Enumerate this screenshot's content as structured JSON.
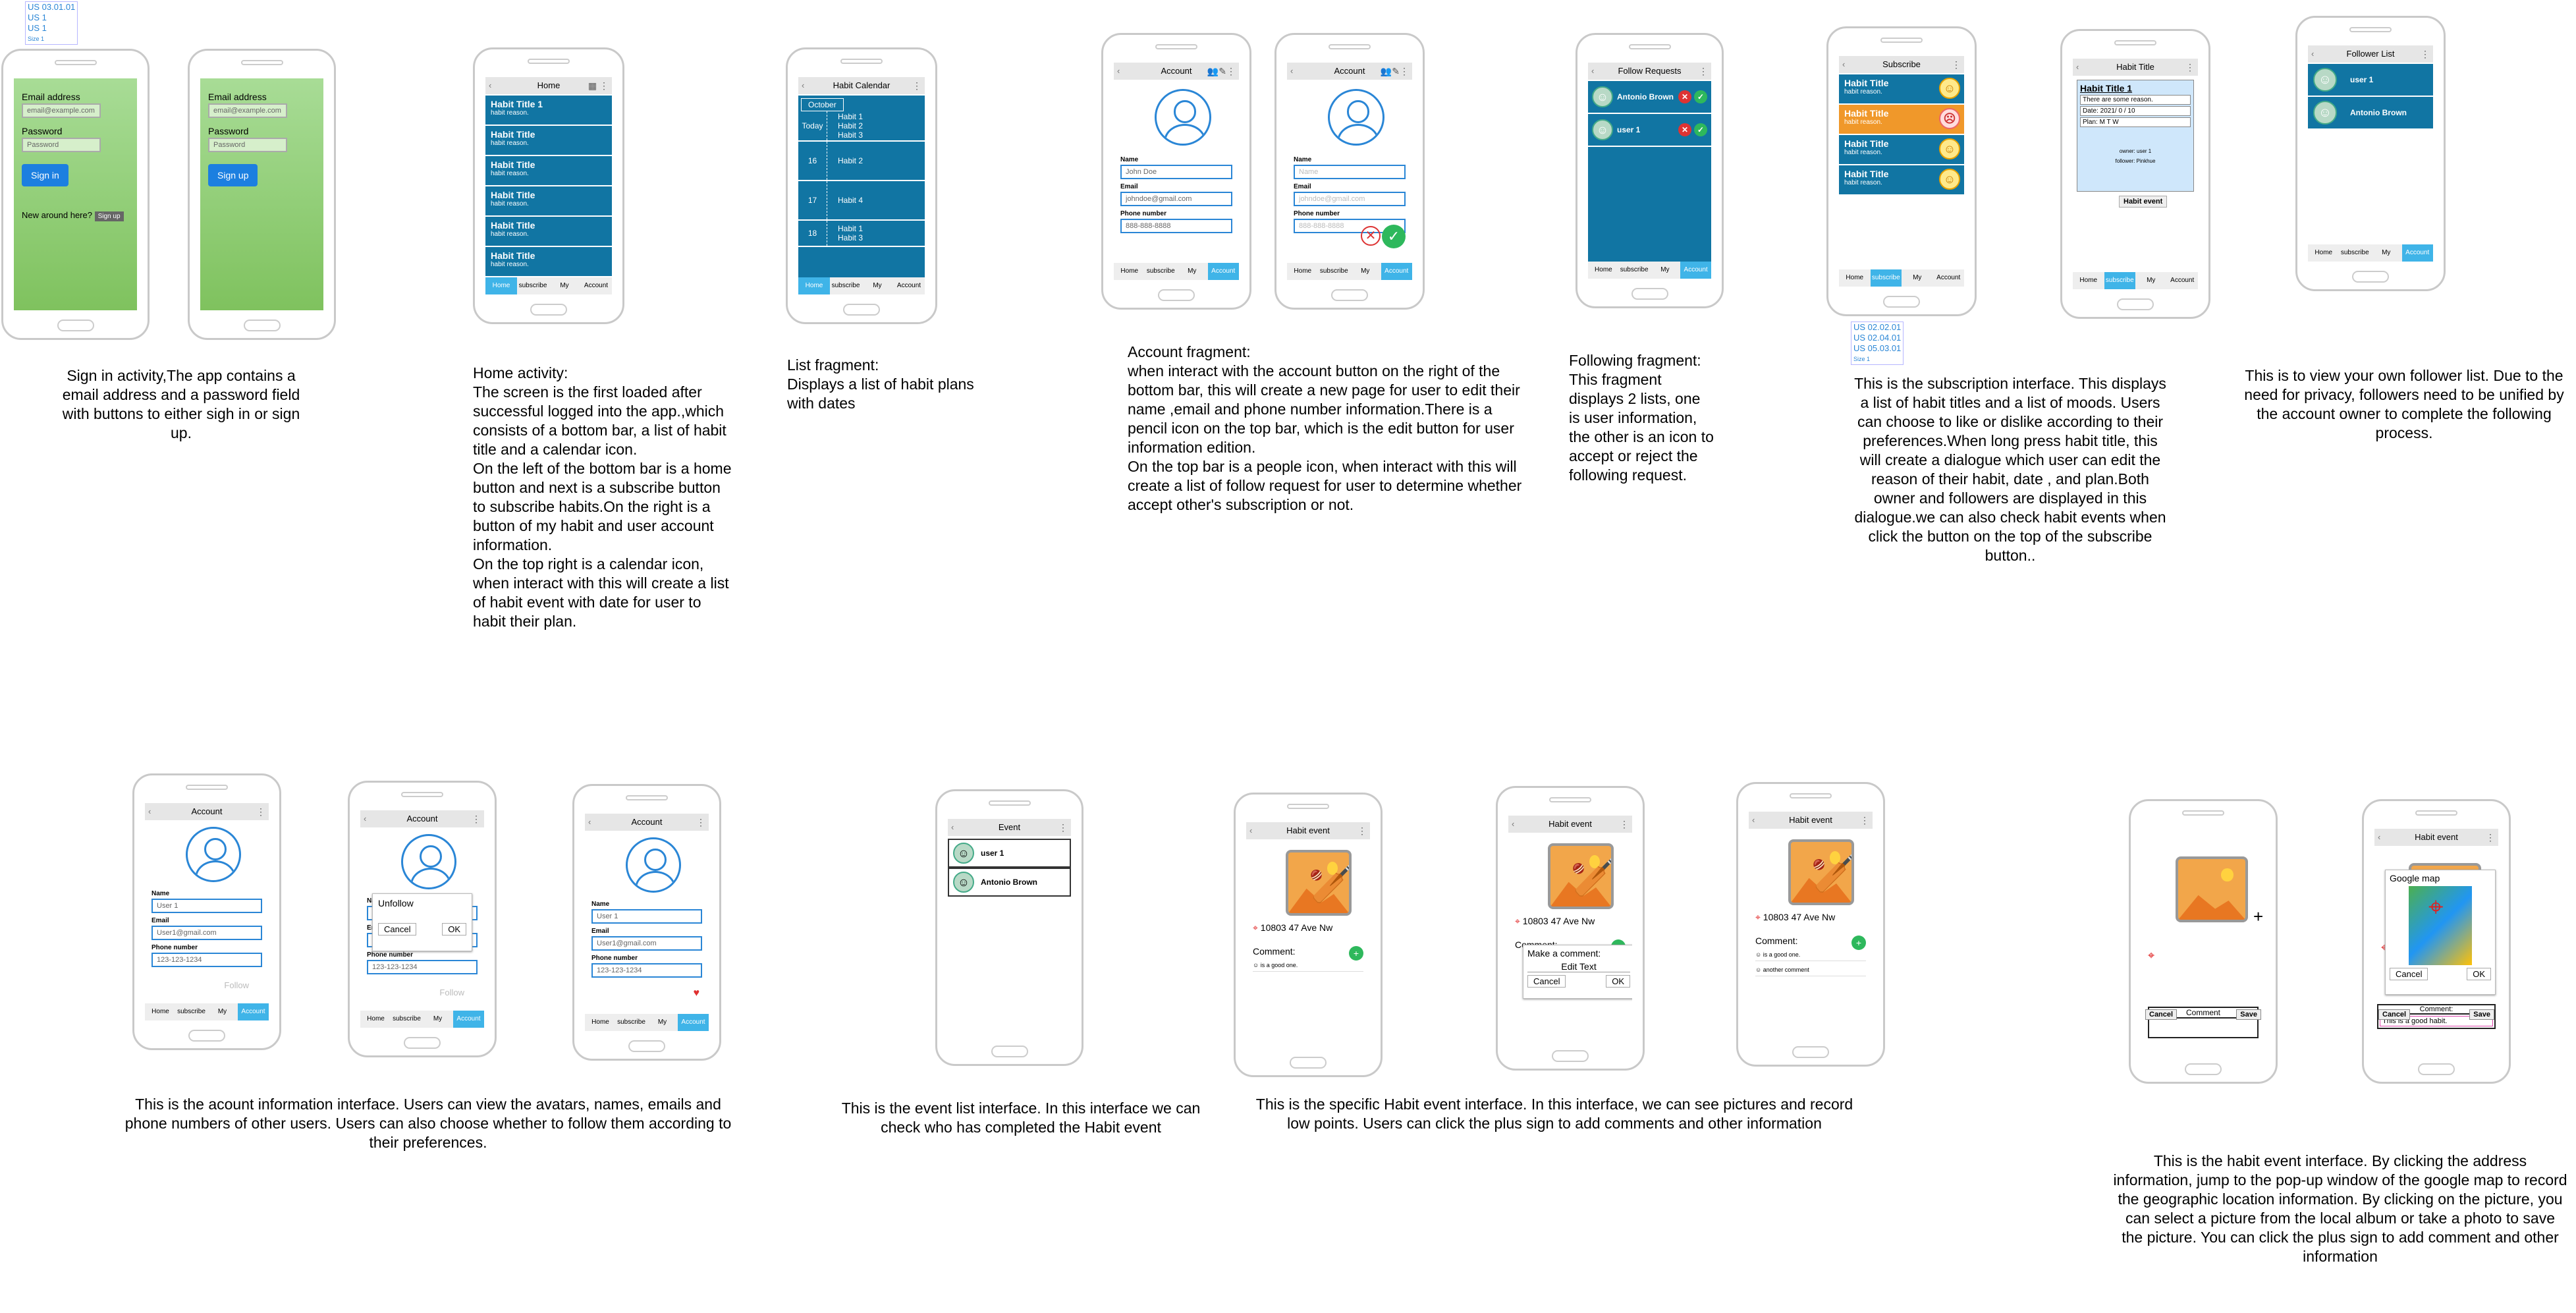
{
  "tags": {
    "top_left": [
      "US 03.01.01",
      "US 1",
      "US 1",
      "Size 1"
    ],
    "sub": [
      "US 02.02.01",
      "US 02.04.01",
      "US 05.03.01",
      "Size 1"
    ]
  },
  "signin": {
    "email_label": "Email address",
    "email_ph": "email@example.com",
    "pwd_label": "Password",
    "pwd_ph": "Password",
    "signin_btn": "Sign in",
    "new_text": "New around here?",
    "signup_small": "Sign up",
    "signup_btn": "Sign up",
    "caption": "Sign in activity,The app contains a email address and a password field with buttons to either sigh in or sign up."
  },
  "nav": {
    "home": "Home",
    "subscribe": "subscribe",
    "my": "My",
    "account": "Account"
  },
  "home": {
    "title": "Home",
    "items": [
      {
        "t": "Habit Title 1",
        "r": "habit reason."
      },
      {
        "t": "Habit Title",
        "r": "habit reason."
      },
      {
        "t": "Habit Title",
        "r": "habit reason."
      },
      {
        "t": "Habit Title",
        "r": "habit reason."
      },
      {
        "t": "Habit Title",
        "r": "habit reason."
      },
      {
        "t": "Habit Title",
        "r": "habit reason."
      }
    ],
    "caption": "Home  activity:\nThe screen is the first loaded after successful logged into  the app.,which consists of a bottom bar, a list of habit title and a calendar icon.\nOn the left of the bottom bar is a home button and next is a subscribe button to subscribe habits.On the right is a button of my habit and user account information.\nOn the  top right is a calendar icon, when interact with this will create a list of habit event with date for user to habit their plan."
  },
  "calendar": {
    "title": "Habit Calendar",
    "month": "October",
    "rows": [
      {
        "d": "Today",
        "h": [
          "Habit 1",
          "Habit 2",
          "Habit 3"
        ]
      },
      {
        "d": "16",
        "h": [
          "Habit 2"
        ]
      },
      {
        "d": "17",
        "h": [
          "Habit 4"
        ]
      },
      {
        "d": "18",
        "h": [
          "Habit 1",
          "Habit 3"
        ]
      }
    ],
    "caption": "List fragment:\nDisplays a list of habit plans with dates"
  },
  "account": {
    "title": "Account",
    "name_label": "Name",
    "email_label": "Email",
    "phone_label": "Phone number",
    "name": "John Doe",
    "email": "johndoe@gmail.com",
    "phone": "888-888-8888",
    "name_ph": "Name",
    "email_ph": "johndoe@gmail.com",
    "phone_ph": "888-888-8888",
    "caption": "Account fragment:\nwhen interact with the account button on the right of the bottom bar, this will create a new page for user to edit their name ,email and phone number information.There is a pencil icon on the top bar, which is the edit button for user information edition.\nOn the top bar  is a people icon, when interact with this will create a list of follow request for user to determine whether accept other's subscription or not."
  },
  "follow": {
    "title": "Follow Requests",
    "users": [
      "Antonio Brown",
      "user 1"
    ],
    "caption": "Following fragment:\nThis fragment displays 2 lists, one is user information, the other is an icon to accept or reject the following request."
  },
  "subscribe": {
    "title": "Subscribe",
    "items": [
      {
        "t": "Habit Title",
        "r": "habit reason."
      },
      {
        "t": "Habit Title",
        "r": "habit reason."
      },
      {
        "t": "Habit Title",
        "r": "habit reason."
      },
      {
        "t": "Habit Title",
        "r": "habit reason."
      }
    ],
    "caption": "This is the subscription interface. This displays a list of habit titles and a list of moods. Users can choose to like or dislike according to their preferences.When long press habit title, this will create a dialogue which user can edit the reason of their habit, date , and  plan.Both owner and followers are displayed in this dialogue.we can also check habit events when click the button on the top of the subscribe button.."
  },
  "habittitle": {
    "title": "Habit Title",
    "head": "Habit Title 1",
    "reason": "There are some reason.",
    "date": "Date: 2021/ 0 / 10",
    "plan": "Plan: M T W",
    "owner": "owner: user 1",
    "follower": "follower: Pinkhue",
    "event_btn": "Habit event"
  },
  "followers": {
    "title": "Follower List",
    "users": [
      "user 1",
      "Antonio Brown"
    ],
    "caption": "This is to view your own follower list. Due to the need for privacy, followers need to be unified by the account owner to complete the following process."
  },
  "acct2": {
    "title": "Account",
    "name": "User 1",
    "email": "User1@gmail.com",
    "phone": "123-123-1234",
    "follow": "Follow",
    "unfollow": "Unfollow",
    "cancel": "Cancel",
    "ok": "OK",
    "caption": "This is the acount information interface. Users can view the avatars, names, emails and phone numbers of other users. Users can also choose whether to follow them according to their preferences."
  },
  "eventlist": {
    "title": "Event",
    "users": [
      "user 1",
      "Antonio Brown"
    ],
    "caption": "This is the event list interface. In this interface we can check who has completed the Habit event"
  },
  "habitevent": {
    "title": "Habit  event",
    "address": "10803 47 Ave Nw",
    "comment": "Comment:",
    "c1": "is a good one.",
    "c2": "another comment",
    "make_comment": "Make a comment:",
    "edit_text": "Edit Text",
    "cancel": "Cancel",
    "ok": "OK",
    "caption": "This is the specific Habit event interface. In this interface, we can see pictures and record low points. Users can click the plus sign to add comments and other information"
  },
  "eventedit": {
    "title": "Habit event",
    "comment_label": "Comment",
    "comment_colon": "Comment:",
    "comment_text": "This is a good habit.",
    "cancel": "Cancel",
    "save": "Save",
    "gmap": "Google map",
    "ok": "OK",
    "caption": "This is the habit event interface. By clicking the address information, jump to the pop-up window of the google map to record the geographic location information. By clicking on the picture, you can select a picture from the local album or take a photo to save the picture. You can click the plus sign to add comment and other information"
  }
}
